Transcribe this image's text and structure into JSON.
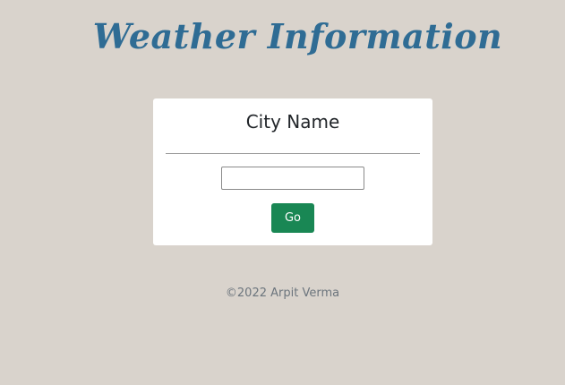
{
  "header": {
    "title": "Weather Information"
  },
  "card": {
    "title": "City Name",
    "input": {
      "value": "",
      "placeholder": ""
    },
    "go_label": "Go"
  },
  "footer": {
    "text": "©2022 Arpit Verma"
  },
  "colors": {
    "background": "#d9d3cc",
    "title": "#2f6c94",
    "button": "#198754"
  }
}
